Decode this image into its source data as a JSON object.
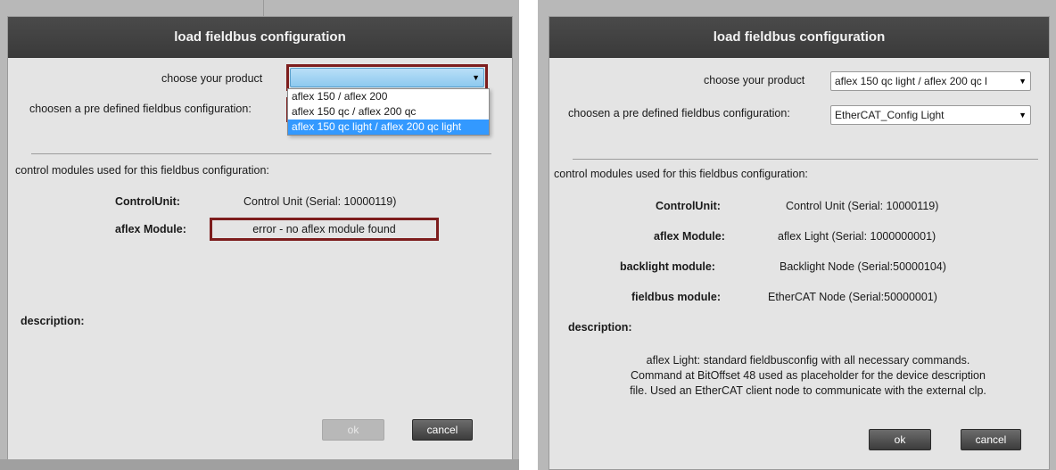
{
  "left_dialog": {
    "title": "load fieldbus configuration",
    "product_label": "choose your product",
    "product_value": "",
    "product_options": [
      "aflex 150 / aflex 200",
      "aflex 150 qc / aflex 200 qc",
      "aflex 150 qc light / aflex 200 qc light"
    ],
    "config_label": "choosen a pre defined fieldbus configuration:",
    "modules_heading": "control modules used for this fieldbus configuration:",
    "modules": [
      {
        "label": "ControlUnit:",
        "value": "Control Unit (Serial: 10000119)"
      },
      {
        "label": "aflex Module:",
        "value": "error - no aflex module found"
      }
    ],
    "description_label": "description:",
    "ok_label": "ok",
    "cancel_label": "cancel"
  },
  "right_dialog": {
    "title": "load fieldbus configuration",
    "product_label": "choose your product",
    "product_value": "aflex 150 qc light / aflex 200 qc l",
    "config_label": "choosen a pre defined fieldbus configuration:",
    "config_value": "EtherCAT_Config Light",
    "modules_heading": "control modules used for this fieldbus configuration:",
    "modules": [
      {
        "label": "ControlUnit:",
        "value": "Control Unit (Serial: 10000119)"
      },
      {
        "label": "aflex Module:",
        "value": "aflex Light (Serial: 1000000001)"
      },
      {
        "label": "backlight module:",
        "value": "Backlight Node (Serial:50000104)"
      },
      {
        "label": "fieldbus module:",
        "value": "EtherCAT Node (Serial:50000001)"
      }
    ],
    "description_label": "description:",
    "description_lines": [
      "aflex Light: standard fieldbusconfig with all necessary commands.",
      "Command at BitOffset 48 used as placeholder for the device description",
      "file. Used an EtherCAT client node to communicate with the external clp."
    ],
    "ok_label": "ok",
    "cancel_label": "cancel"
  },
  "colors": {
    "titlebar": "#3f3f3f",
    "dialog_bg": "#e4e4e4",
    "error_border": "#7d1d1d",
    "selection": "#3399ff"
  },
  "icons": [
    "dropdown-arrow-icon"
  ]
}
